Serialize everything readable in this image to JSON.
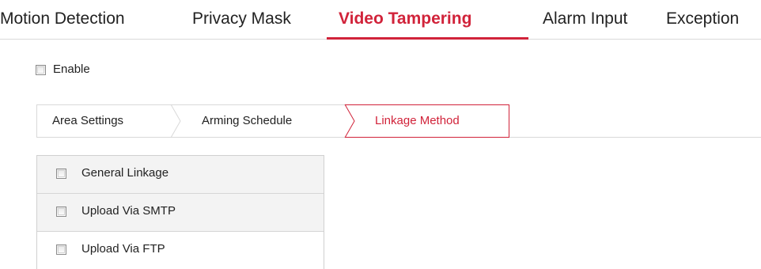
{
  "top_tabs": [
    {
      "label": "Motion Detection",
      "active": false
    },
    {
      "label": "Privacy Mask",
      "active": false
    },
    {
      "label": "Video Tampering",
      "active": true
    },
    {
      "label": "Alarm Input",
      "active": false
    },
    {
      "label": "Exception",
      "active": false
    }
  ],
  "enable": {
    "label": "Enable",
    "checked": false
  },
  "sub_tabs": [
    {
      "label": "Area Settings",
      "active": false
    },
    {
      "label": "Arming Schedule",
      "active": false
    },
    {
      "label": "Linkage Method",
      "active": true
    }
  ],
  "linkage": {
    "items": [
      {
        "label": "General Linkage",
        "checked": false
      },
      {
        "label": "Upload Via SMTP",
        "checked": false
      },
      {
        "label": "Upload Via FTP",
        "checked": false
      }
    ]
  },
  "colors": {
    "accent": "#d1233a",
    "border": "#d9d9d9",
    "text": "#222222",
    "row_shade": "#f3f3f3"
  }
}
